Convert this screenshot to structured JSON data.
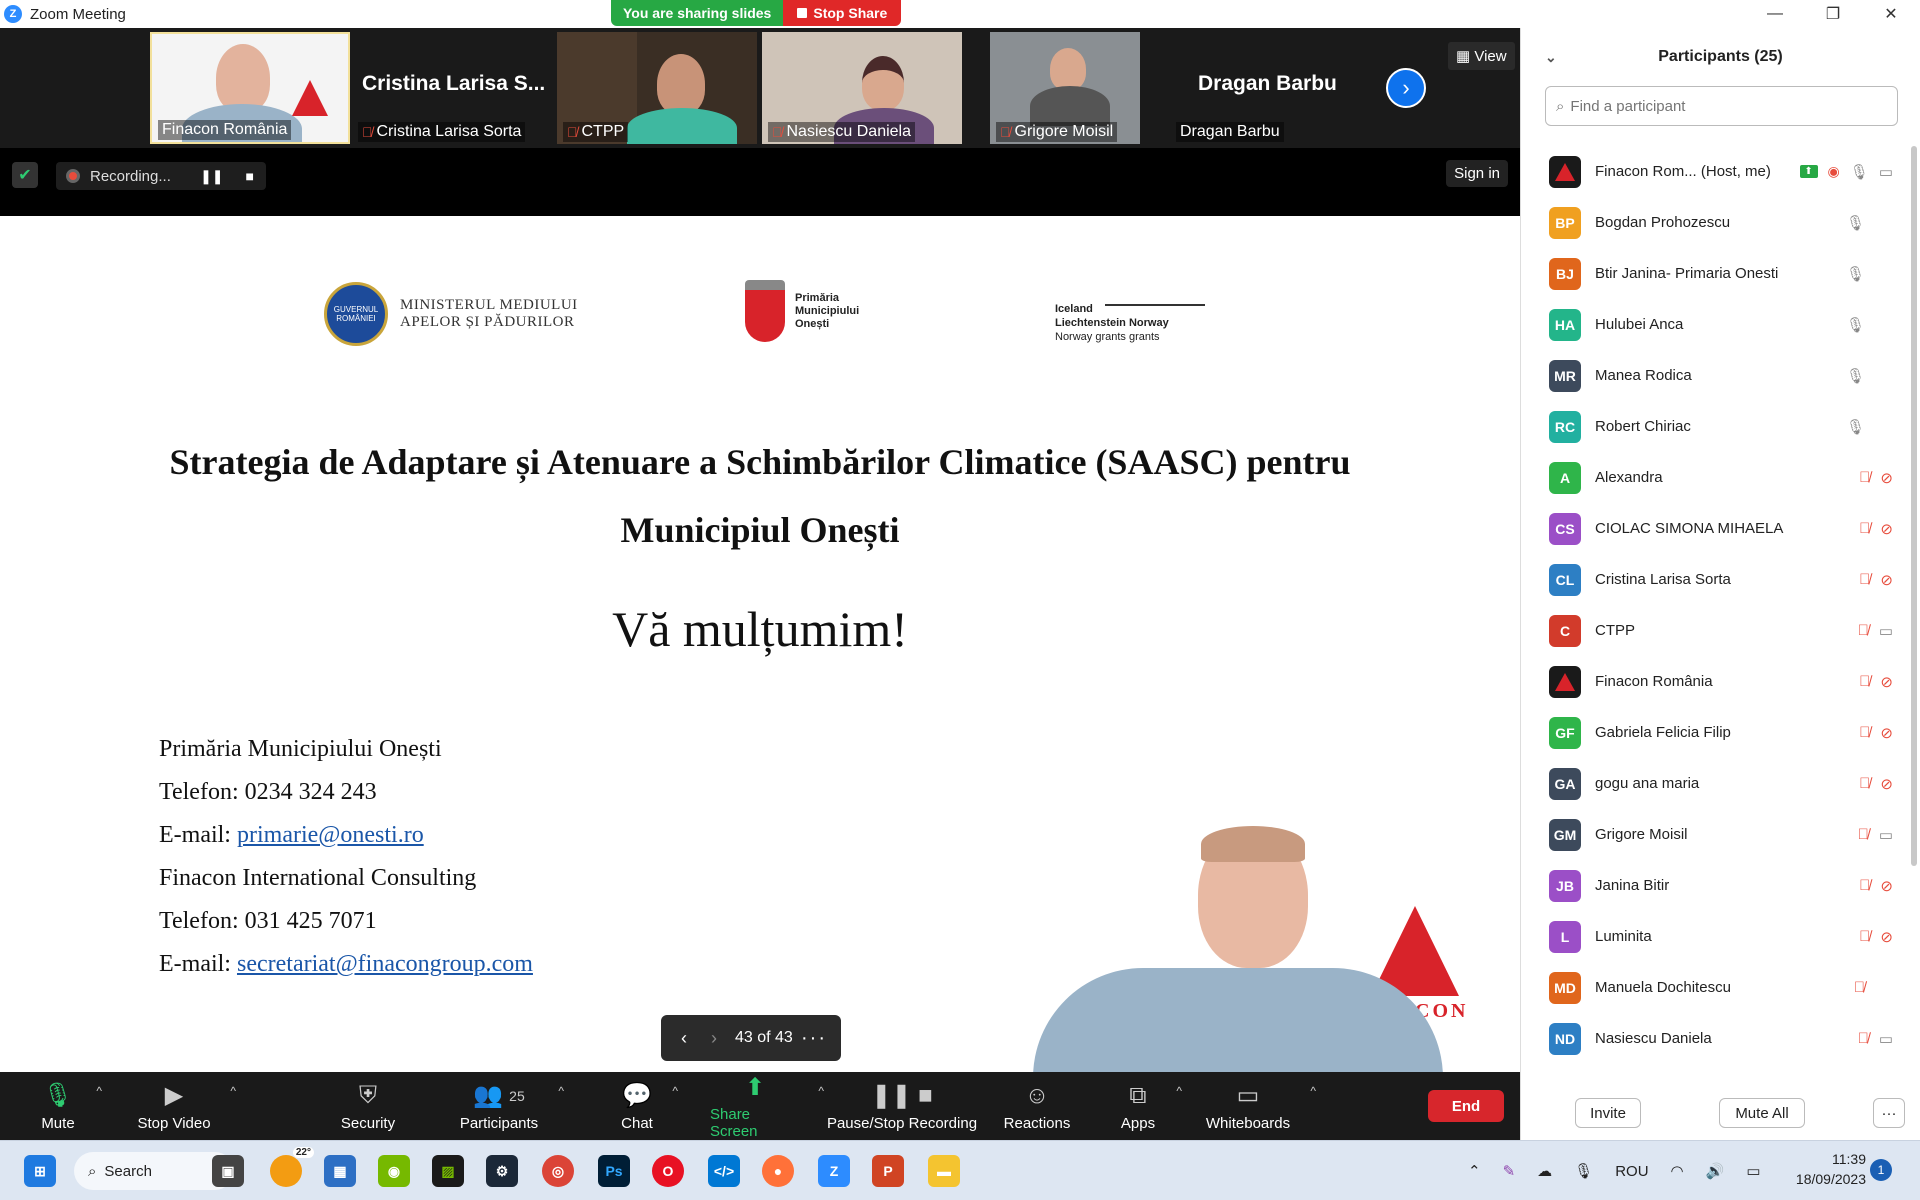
{
  "window": {
    "title": "Zoom Meeting",
    "controls": [
      "—",
      "❐",
      "✕"
    ]
  },
  "share_banner": {
    "status": "You are sharing slides",
    "stop_label": "Stop Share"
  },
  "video_strip": {
    "tiles": [
      {
        "name": "Finacon România",
        "big_name": "",
        "muted": false
      },
      {
        "name": "Cristina Larisa Sorta",
        "big_name": "Cristina  Larisa  S...",
        "muted": true
      },
      {
        "name": "CTPP",
        "big_name": "",
        "muted": true
      },
      {
        "name": "Nasiescu Daniela",
        "big_name": "",
        "muted": true
      },
      {
        "name": "Grigore Moisil",
        "big_name": "",
        "muted": true
      },
      {
        "name": "Dragan Barbu",
        "big_name": "Dragan Barbu",
        "muted": false
      }
    ],
    "view_label": "View",
    "next_icon": "›"
  },
  "recording": {
    "label": "Recording...",
    "pause_icon": "❚❚",
    "stop_icon": "■",
    "signin_label": "Sign in"
  },
  "slide": {
    "ministry_line1": "MINISTERUL MEDIULUI",
    "ministry_line2": "APELOR ȘI PĂDURILOR",
    "seal_text": "GUVERNUL ROMÂNIEI",
    "primaria_line1": "Primăria",
    "primaria_line2": "Municipiului",
    "primaria_line3": "Onești",
    "eea_line1": "Iceland",
    "eea_line2": "Liechtenstein  Norway",
    "eea_line3": "Norway grants    grants",
    "title_line1": "Strategia de Adaptare și Atenuare a Schimbărilor Climatice (SAASC) pentru",
    "title_line2": "Municipiul Onești",
    "thanks": "Vă mulțumim!",
    "contact": {
      "org1": "Primăria Municipiului  Onești",
      "phone1_label": "Telefon:",
      "phone1": "0234 324 243",
      "email1_label": "E-mail:",
      "email1": "primarie@onesti.ro",
      "org2": "Finacon International  Consulting",
      "phone2_label": "Telefon:",
      "phone2": "031 425 7071",
      "email2_label": "E-mail:",
      "email2": "secretariat@finacongroup.com"
    },
    "presenter_logo": "CON"
  },
  "slide_nav": {
    "prev_icon": "‹",
    "next_icon": "›",
    "counter": "43 of 43",
    "more_icon": "···"
  },
  "toolbar": {
    "mute": "Mute",
    "stop_video": "Stop Video",
    "security": "Security",
    "participants": "Participants",
    "participants_count": "25",
    "chat": "Chat",
    "share_screen": "Share Screen",
    "recording": "Pause/Stop Recording",
    "reactions": "Reactions",
    "apps": "Apps",
    "whiteboards": "Whiteboards",
    "end": "End"
  },
  "participants_panel": {
    "title": "Participants (25)",
    "search_placeholder": "Find a participant",
    "items": [
      {
        "initials": "",
        "name": "Finacon Rom...  (Host, me)",
        "color": "#1a1a1a",
        "mic": "on",
        "cam": "on",
        "host": true
      },
      {
        "initials": "BP",
        "name": "Bogdan Prohozescu",
        "color": "#f0a020",
        "mic": "on",
        "cam": "none"
      },
      {
        "initials": "BJ",
        "name": "Btir Janina- Primaria  Onesti",
        "color": "#e0661c",
        "mic": "on",
        "cam": "none"
      },
      {
        "initials": "HA",
        "name": "Hulubei Anca",
        "color": "#23b58a",
        "mic": "on",
        "cam": "none"
      },
      {
        "initials": "MR",
        "name": "Manea Rodica",
        "color": "#3d4a5c",
        "mic": "on",
        "cam": "none"
      },
      {
        "initials": "RC",
        "name": "Robert Chiriac",
        "color": "#22b0a0",
        "mic": "on",
        "cam": "none"
      },
      {
        "initials": "A",
        "name": "Alexandra",
        "color": "#2fb54a",
        "mic": "off",
        "cam": "off"
      },
      {
        "initials": "CS",
        "name": "CIOLAC SIMONA MIHAELA",
        "color": "#9b4fc7",
        "mic": "off",
        "cam": "off"
      },
      {
        "initials": "CL",
        "name": "Cristina Larisa Sorta",
        "color": "#2d7fc4",
        "mic": "off",
        "cam": "off"
      },
      {
        "initials": "C",
        "name": "CTPP",
        "color": "#d23b2b",
        "mic": "off",
        "cam": "on"
      },
      {
        "initials": "",
        "name": "Finacon România",
        "color": "#1a1a1a",
        "mic": "off",
        "cam": "off"
      },
      {
        "initials": "GF",
        "name": "Gabriela Felicia Filip",
        "color": "#2fb54a",
        "mic": "off",
        "cam": "off"
      },
      {
        "initials": "GA",
        "name": "gogu ana maria",
        "color": "#3d4a5c",
        "mic": "off",
        "cam": "off"
      },
      {
        "initials": "GM",
        "name": "Grigore Moisil",
        "color": "#3d4a5c",
        "mic": "off",
        "cam": "on"
      },
      {
        "initials": "JB",
        "name": "Janina Bitir",
        "color": "#9b4fc7",
        "mic": "off",
        "cam": "off"
      },
      {
        "initials": "L",
        "name": "Luminita",
        "color": "#9b4fc7",
        "mic": "off",
        "cam": "off"
      },
      {
        "initials": "MD",
        "name": "Manuela Dochitescu",
        "color": "#e0661c",
        "mic": "off",
        "cam": "none"
      },
      {
        "initials": "ND",
        "name": "Nasiescu Daniela",
        "color": "#2d7fc4",
        "mic": "off",
        "cam": "on"
      }
    ],
    "invite": "Invite",
    "mute_all": "Mute All",
    "more": "···"
  },
  "taskbar": {
    "search_label": "Search",
    "weather": "22°",
    "language": "ROU",
    "time": "11:39",
    "date": "18/09/2023",
    "notifications": "1"
  }
}
